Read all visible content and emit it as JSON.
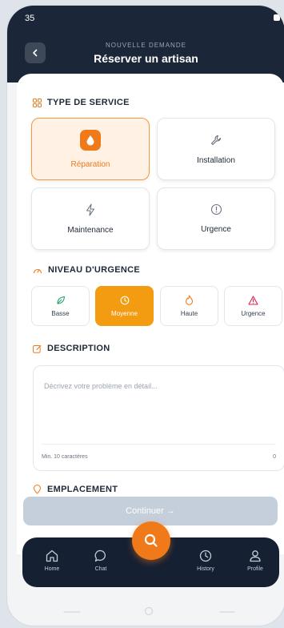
{
  "status_bar": {
    "time": "35"
  },
  "header": {
    "subtitle": "NOUVELLE DEMANDE",
    "title": "Réserver un artisan"
  },
  "service_type": {
    "title": "TYPE DE SERVICE",
    "options": [
      {
        "label": "Réparation",
        "icon": "drop-icon",
        "selected": true
      },
      {
        "label": "Installation",
        "icon": "wrench-icon",
        "selected": false
      },
      {
        "label": "Maintenance",
        "icon": "bolt-icon",
        "selected": false
      },
      {
        "label": "Urgence",
        "icon": "alert-circle-icon",
        "selected": false
      }
    ]
  },
  "urgency": {
    "title": "NIVEAU D'URGENCE",
    "levels": [
      {
        "label": "Basse",
        "icon": "leaf-icon",
        "selected": false
      },
      {
        "label": "Moyenne",
        "icon": "clock-icon",
        "selected": true
      },
      {
        "label": "Haute",
        "icon": "flame-icon",
        "selected": false
      },
      {
        "label": "Urgence",
        "icon": "warning-triangle-icon",
        "selected": false
      }
    ]
  },
  "description": {
    "title": "DESCRIPTION",
    "placeholder": "Décrivez votre problème en détail...",
    "min_hint": "Min. 10 caractères",
    "count": "0"
  },
  "location": {
    "title": "EMPLACEMENT"
  },
  "continue_button": {
    "label": "Continuer →"
  },
  "bottom_nav": {
    "items": [
      {
        "label": "Home",
        "icon": "home-icon"
      },
      {
        "label": "Chat",
        "icon": "chat-icon"
      },
      {
        "label": "",
        "icon": "search-icon"
      },
      {
        "label": "History",
        "icon": "history-icon"
      },
      {
        "label": "Profile",
        "icon": "profile-icon"
      }
    ]
  },
  "colors": {
    "accent": "#f07a1a",
    "header_bg": "#1b2638",
    "selected_urgency": "#f39c12",
    "disabled_button": "#c5cedb",
    "nav_bg": "#162033"
  }
}
